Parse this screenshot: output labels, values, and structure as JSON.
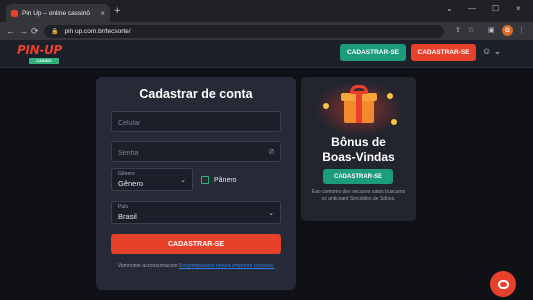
{
  "browser": {
    "tab_title": "Pin Up – online cassinô",
    "close_tab": "×",
    "new_tab": "+",
    "url": "pin up.com.br/tecsorte/",
    "window_controls": [
      "⌄",
      "—",
      "☐",
      "×"
    ],
    "nav": {
      "back": "←",
      "forward": "→",
      "reload": "⟳"
    },
    "profile_initial": "G"
  },
  "header": {
    "logo_text": "PIN-UP",
    "logo_sub": "CASINO",
    "btn_secondary": "CADASTRAR-SE",
    "btn_primary": "CADASTRAR-SE",
    "user_icon": "☺ ⌄"
  },
  "form": {
    "title": "Cadastrar de conta",
    "phone_placeholder": "Celular",
    "password_placeholder": "Senha",
    "gender": {
      "label": "Gênero",
      "value": "Gênero"
    },
    "checkbox_label": "Pânero",
    "country": {
      "label": "País",
      "value": "Brasil"
    },
    "submit": "CADASTRAR-SE",
    "terms_text": "Vomnome acroozumacion ",
    "terms_link": "Borgomparaplo neruta empreire consess."
  },
  "bonus": {
    "title_line1": "Bônus de",
    "title_line2": "Boas-Vindas",
    "button": "CADASTRAR-SE",
    "description": "Eao comomo des secuces satos buscams os anticoant Sincoldes de Sdnos."
  },
  "colors": {
    "accent_red": "#e8412b",
    "accent_teal": "#1d9b7d",
    "page_bg": "#0f1117",
    "card_bg": "#252a36"
  }
}
